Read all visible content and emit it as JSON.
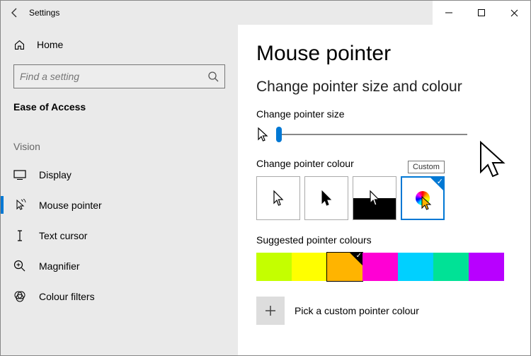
{
  "window": {
    "app_title": "Settings"
  },
  "sidebar": {
    "home_label": "Home",
    "search_placeholder": "Find a setting",
    "section": "Ease of Access",
    "group": "Vision",
    "items": [
      {
        "label": "Display"
      },
      {
        "label": "Mouse pointer"
      },
      {
        "label": "Text cursor"
      },
      {
        "label": "Magnifier"
      },
      {
        "label": "Colour filters"
      }
    ]
  },
  "main": {
    "title": "Mouse pointer",
    "subtitle": "Change pointer size and colour",
    "size_label": "Change pointer size",
    "colour_label": "Change pointer colour",
    "custom_tooltip": "Custom",
    "suggested_label": "Suggested pointer colours",
    "suggested_colours": [
      "#c4ff00",
      "#ffff00",
      "#ffb400",
      "#ff00d4",
      "#00d0ff",
      "#00e296",
      "#b800ff"
    ],
    "suggested_selected_index": 2,
    "pick_custom": "Pick a custom pointer colour"
  }
}
